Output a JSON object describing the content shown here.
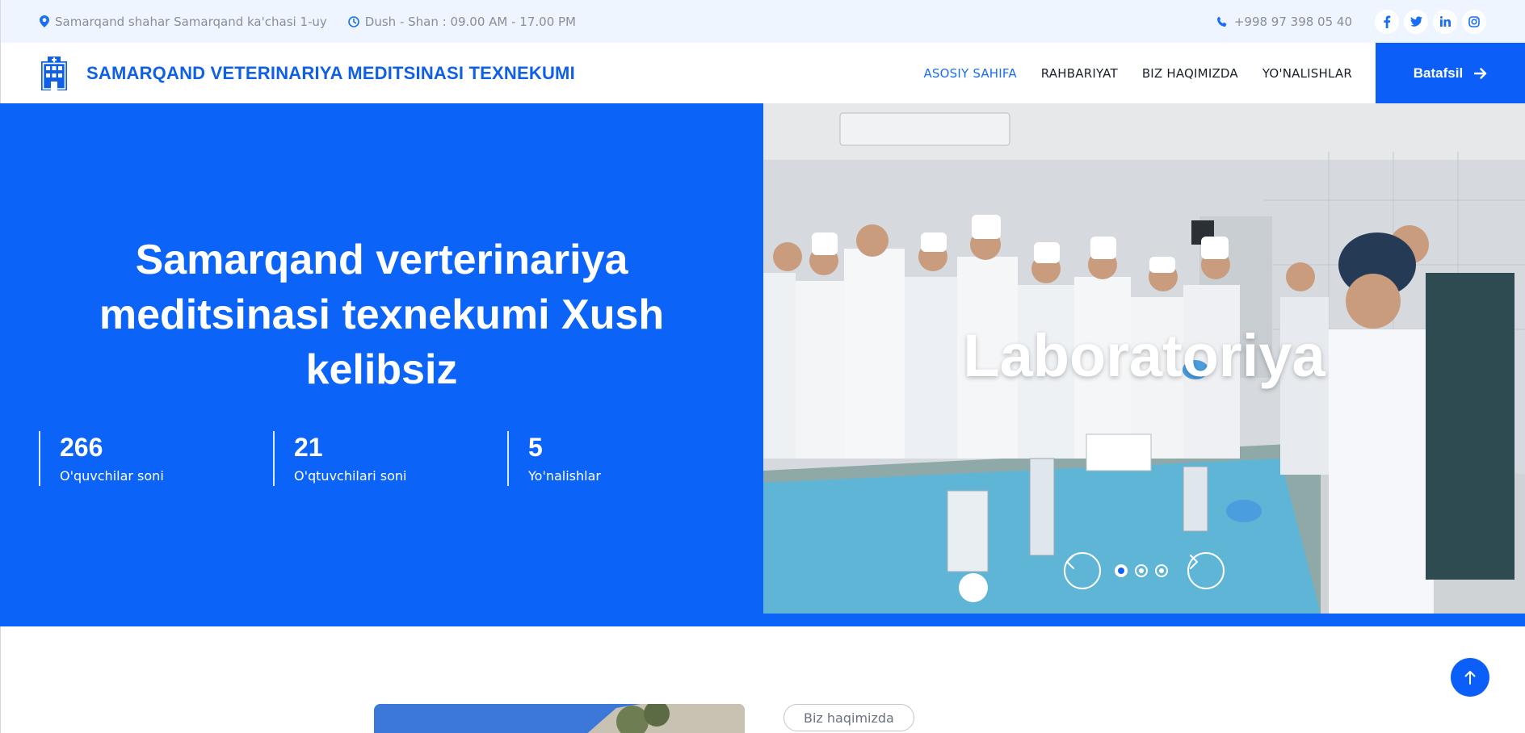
{
  "topbar": {
    "address": "Samarqand shahar Samarqand ka'chasi 1-uy",
    "hours": "Dush - Shan : 09.00 AM - 17.00 PM",
    "phone": "+998 97 398 05 40",
    "social": [
      "facebook-icon",
      "twitter-icon",
      "linkedin-icon",
      "instagram-icon"
    ]
  },
  "nav": {
    "brand": "SAMARQAND VETERINARIYA MEDITSINASI TEXNEKUMI",
    "items": [
      {
        "label": "ASOSIY SAHIFA",
        "active": true
      },
      {
        "label": "RAHBARIYAT",
        "active": false
      },
      {
        "label": "BIZ HAQIMIZDA",
        "active": false
      },
      {
        "label": "YO'NALISHLAR",
        "active": false
      }
    ],
    "cta": "Batafsil"
  },
  "hero": {
    "title": "Samarqand verterinariya meditsinasi texnekumi Xush kelibsiz",
    "stats": [
      {
        "value": "266",
        "label": "O'quvchilar soni"
      },
      {
        "value": "21",
        "label": "O'qtuvchilari soni"
      },
      {
        "value": "5",
        "label": "Yo'nalishlar"
      }
    ],
    "slide_title": "Laboratoriya",
    "slide_count": 3,
    "active_slide": 1
  },
  "about": {
    "badge": "Biz haqimizda"
  },
  "colors": {
    "primary": "#0b63f8",
    "brand_text": "#1060e6",
    "topbar_bg": "#eef5fe"
  }
}
